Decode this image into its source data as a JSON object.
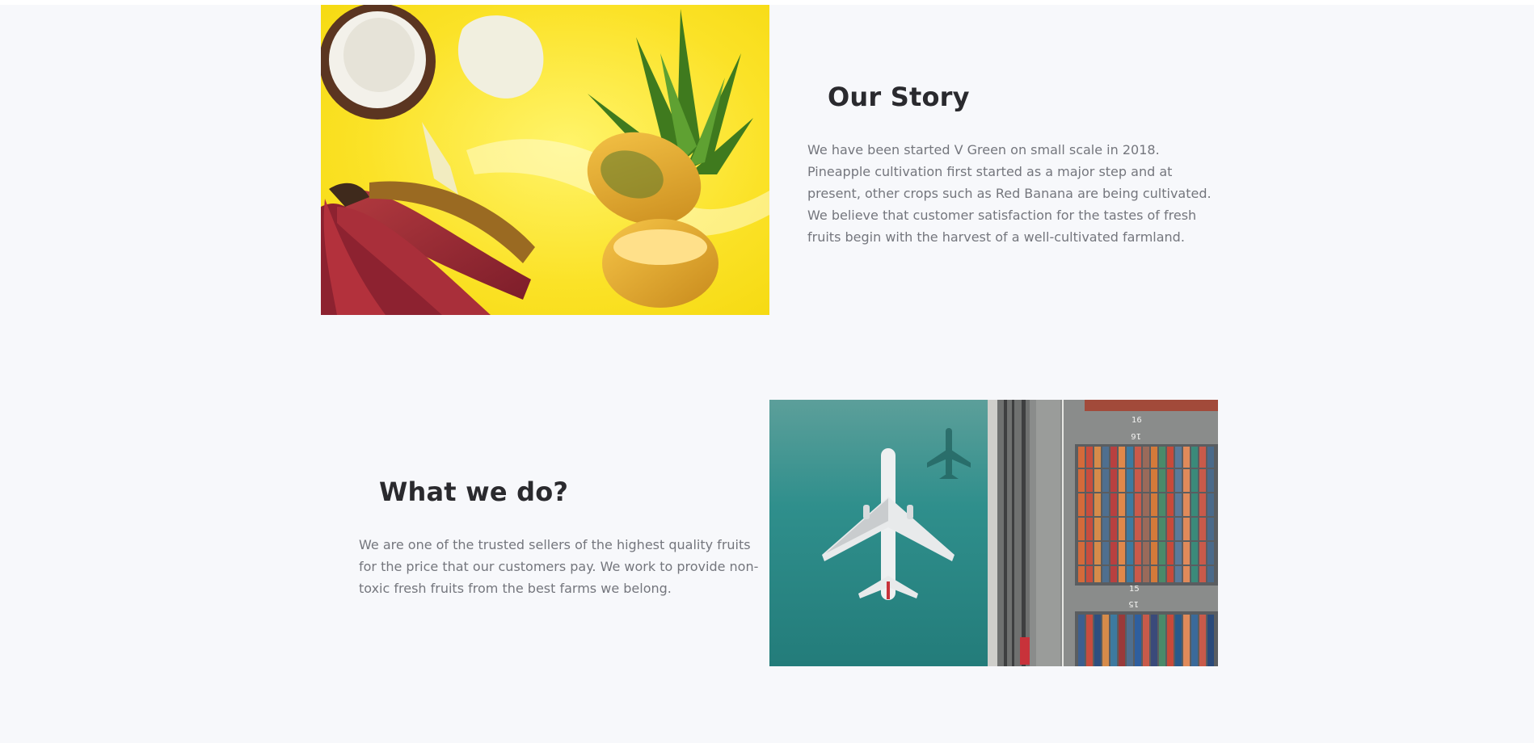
{
  "sections": {
    "story": {
      "title": "Our Story",
      "body": "We have been started V Green on small scale in 2018. Pineapple cultivation first started as a major step and at present, other crops such as Red Banana are being cultivated. We believe that customer satisfaction for the tastes of fresh fruits begin with the harvest of a well-cultivated farmland."
    },
    "what_we_do": {
      "title": "What we do?",
      "body": "We are one of the trusted sellers of the highest quality fruits for the price that our customers pay. We work to provide non-toxic fresh fruits from the best farms we belong."
    }
  },
  "port_image": {
    "berth_labels": [
      "16",
      "16",
      "15",
      "15"
    ]
  },
  "colors": {
    "background": "#f7f8fb",
    "heading": "#2a2a2e",
    "body_text": "#74767d",
    "fruit_bg": "#fbe227",
    "sea": "#2f8f8c"
  }
}
